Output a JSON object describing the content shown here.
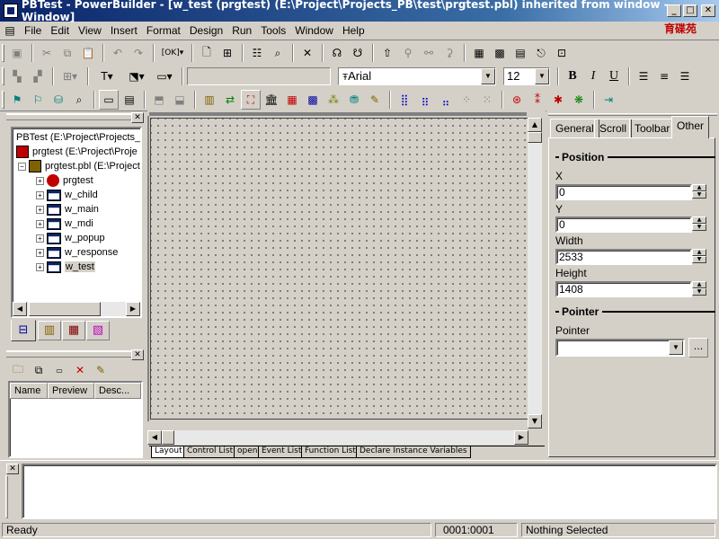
{
  "window": {
    "title": "PBTest - PowerBuilder - [w_test (prgtest) (E:\\Project\\Projects_PB\\test\\prgtest.pbl) inherited from window - Window]",
    "logo_text": "育碟苑"
  },
  "menu": [
    "File",
    "Edit",
    "View",
    "Insert",
    "Format",
    "Design",
    "Run",
    "Tools",
    "Window",
    "Help"
  ],
  "font_toolbar": {
    "font_name": "Arial",
    "font_size": "12",
    "bold": "B",
    "italic": "I",
    "underline": "U"
  },
  "library_tree": {
    "root": "PBTest (E:\\Project\\Projects_",
    "target": "prgtest (E:\\Project\\Proje",
    "pbl": "prgtest.pbl (E:\\Project",
    "items": [
      "prgtest",
      "w_child",
      "w_main",
      "w_mdi",
      "w_popup",
      "w_response",
      "w_test"
    ]
  },
  "todo_panel": {
    "columns": [
      "Name",
      "Preview",
      "Desc..."
    ]
  },
  "layout_tabs": [
    "Layout",
    "Control List",
    "open",
    "Event List",
    "Function List",
    "Declare Instance Variables"
  ],
  "properties": {
    "tabs": [
      "General",
      "Scroll",
      "Toolbar",
      "Other"
    ],
    "position_header": "Position",
    "x_label": "X",
    "x_value": "0",
    "y_label": "Y",
    "y_value": "0",
    "width_label": "Width",
    "width_value": "2533",
    "height_label": "Height",
    "height_value": "1408",
    "pointer_header": "Pointer",
    "pointer_label": "Pointer",
    "pointer_value": "",
    "browse_label": "..."
  },
  "status": {
    "text": "Ready",
    "position": "0001:0001",
    "selection": "Nothing Selected"
  },
  "colors": {
    "title_start": "#0a246a",
    "title_end": "#a6caf0",
    "face": "#d4d0c8"
  }
}
